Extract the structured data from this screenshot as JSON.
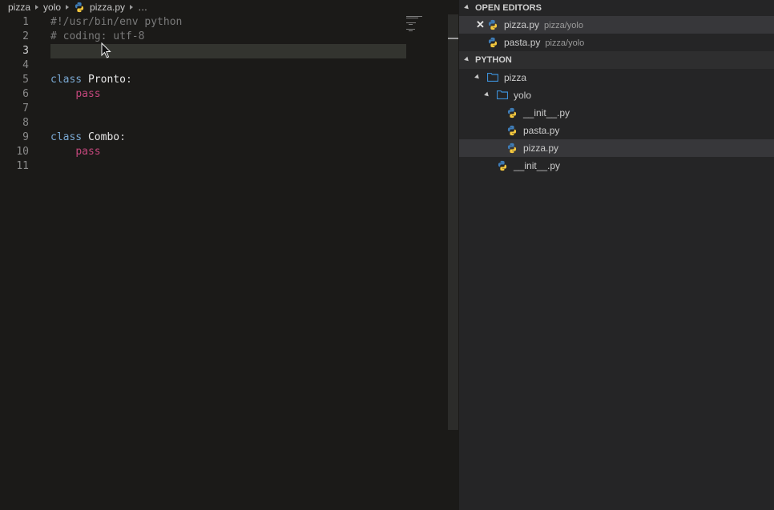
{
  "breadcrumbs": [
    "pizza",
    "yolo",
    "pizza.py",
    "…"
  ],
  "editor": {
    "lines": [
      {
        "n": "1",
        "parts": [
          {
            "t": "#!/usr/bin/env python",
            "c": "comment"
          }
        ]
      },
      {
        "n": "2",
        "parts": [
          {
            "t": "# coding: utf-8",
            "c": "comment"
          }
        ]
      },
      {
        "n": "3",
        "parts": []
      },
      {
        "n": "4",
        "parts": []
      },
      {
        "n": "5",
        "parts": [
          {
            "t": "class",
            "c": "kw"
          },
          {
            "t": " ",
            "c": "pl"
          },
          {
            "t": "Pronto",
            "c": "cls"
          },
          {
            "t": ":",
            "c": "pl"
          }
        ]
      },
      {
        "n": "6",
        "parts": [
          {
            "t": "    ",
            "c": "pl"
          },
          {
            "t": "pass",
            "c": "pass"
          }
        ]
      },
      {
        "n": "7",
        "parts": []
      },
      {
        "n": "8",
        "parts": []
      },
      {
        "n": "9",
        "parts": [
          {
            "t": "class",
            "c": "kw"
          },
          {
            "t": " ",
            "c": "pl"
          },
          {
            "t": "Combo",
            "c": "cls"
          },
          {
            "t": ":",
            "c": "pl"
          }
        ]
      },
      {
        "n": "10",
        "parts": [
          {
            "t": "    ",
            "c": "pl"
          },
          {
            "t": "pass",
            "c": "pass"
          }
        ]
      },
      {
        "n": "11",
        "parts": []
      }
    ],
    "active_line": "3"
  },
  "sidebar": {
    "open_editors_title": "OPEN EDITORS",
    "open_editors": [
      {
        "name": "pizza.py",
        "path": "pizza/yolo",
        "icon": "python-icon",
        "close": "✕"
      },
      {
        "name": "pasta.py",
        "path": "pizza/yolo",
        "icon": "python-icon"
      }
    ],
    "project_title": "PYTHON",
    "tree": {
      "pizza": "pizza",
      "yolo": "yolo",
      "init_yolo": "__init__.py",
      "pasta": "pasta.py",
      "pizza_py": "pizza.py",
      "init_pizza": "__init__.py"
    }
  },
  "colors": {
    "editor_bg": "#1b1a18",
    "sidebar_bg": "#252526",
    "keyword": "#79a7d1",
    "pass_keyword": "#c4477c",
    "comment": "#7a7a7a",
    "folder": "#3c8fd6"
  }
}
